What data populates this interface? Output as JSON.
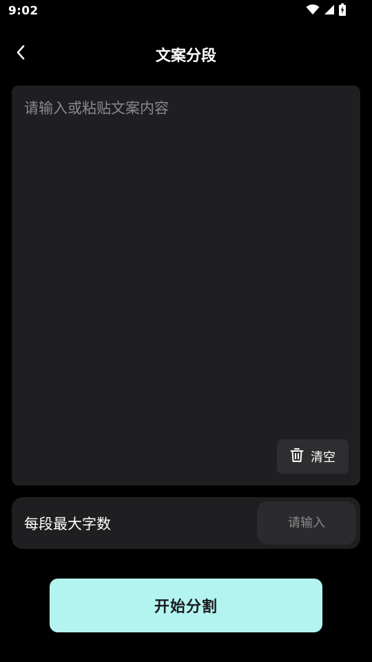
{
  "status_bar": {
    "time": "9:02",
    "icons": [
      "wifi-icon",
      "cellular-signal-icon",
      "battery-charging-icon"
    ]
  },
  "header": {
    "back_icon": "chevron-left-icon",
    "title": "文案分段"
  },
  "text_area": {
    "placeholder": "请输入或粘贴文案内容",
    "value": "",
    "clear_button": {
      "icon": "trash-icon",
      "label": "清空"
    }
  },
  "max_chars": {
    "label": "每段最大字数",
    "placeholder": "请输入",
    "value": ""
  },
  "start_button": {
    "label": "开始分割"
  },
  "colors": {
    "background": "#000000",
    "card": "#1f1f21",
    "accent": "#b3f4f1",
    "placeholder": "#8a8a8c"
  }
}
